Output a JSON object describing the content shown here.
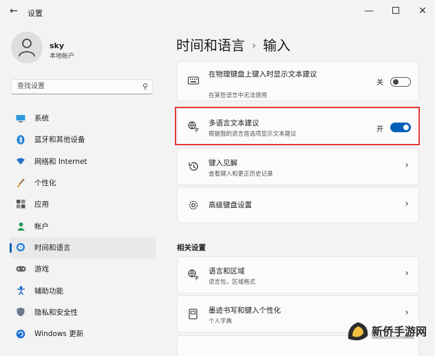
{
  "window": {
    "title": "设置",
    "back_icon": "back-arrow-icon"
  },
  "user": {
    "name": "sky",
    "account_type": "本地帐户"
  },
  "search": {
    "placeholder": "查找设置"
  },
  "sidebar": {
    "items": [
      {
        "label": "系统",
        "icon": "monitor-icon",
        "active": false
      },
      {
        "label": "蓝牙和其他设备",
        "icon": "bluetooth-icon",
        "active": false
      },
      {
        "label": "网络和 Internet",
        "icon": "wifi-icon",
        "active": false
      },
      {
        "label": "个性化",
        "icon": "brush-icon",
        "active": false
      },
      {
        "label": "应用",
        "icon": "apps-icon",
        "active": false
      },
      {
        "label": "帐户",
        "icon": "person-icon",
        "active": false
      },
      {
        "label": "时间和语言",
        "icon": "globe-clock-icon",
        "active": true
      },
      {
        "label": "游戏",
        "icon": "gamepad-icon",
        "active": false
      },
      {
        "label": "辅助功能",
        "icon": "accessibility-icon",
        "active": false
      },
      {
        "label": "隐私和安全性",
        "icon": "shield-icon",
        "active": false
      },
      {
        "label": "Windows 更新",
        "icon": "update-icon",
        "active": false
      }
    ]
  },
  "breadcrumb": {
    "parent": "时间和语言",
    "current": "输入"
  },
  "settings": [
    {
      "title": "在物理键盘上键入时显示文本建议",
      "desc": "在某些语言中无法使用",
      "icon": "keyboard-icon",
      "control": "toggle",
      "state_label": "关",
      "on": false
    },
    {
      "title": "多语言文本建议",
      "desc": "根据我的语言首选项显示文本建议",
      "icon": "language-icon",
      "control": "toggle",
      "state_label": "开",
      "on": true
    },
    {
      "title": "键入见解",
      "desc": "查看键入和更正历史记录",
      "icon": "history-icon",
      "control": "chevron"
    },
    {
      "title": "高级键盘设置",
      "desc": "",
      "icon": "gear-icon",
      "control": "chevron"
    }
  ],
  "related": {
    "heading": "相关设置",
    "items": [
      {
        "title": "语言和区域",
        "desc": "语言包，区域格式",
        "icon": "language-icon"
      },
      {
        "title": "墨迹书写和键入个性化",
        "desc": "个人字典",
        "icon": "notebook-icon"
      }
    ]
  },
  "colors": {
    "accent": "#005fb8",
    "highlight": "#e53a3a",
    "background": "#f3f3f3",
    "card": "#fbfbfb"
  },
  "watermark": {
    "text": "新侨手游网",
    "url": "XINQIAOSHOUYOUWANG"
  }
}
